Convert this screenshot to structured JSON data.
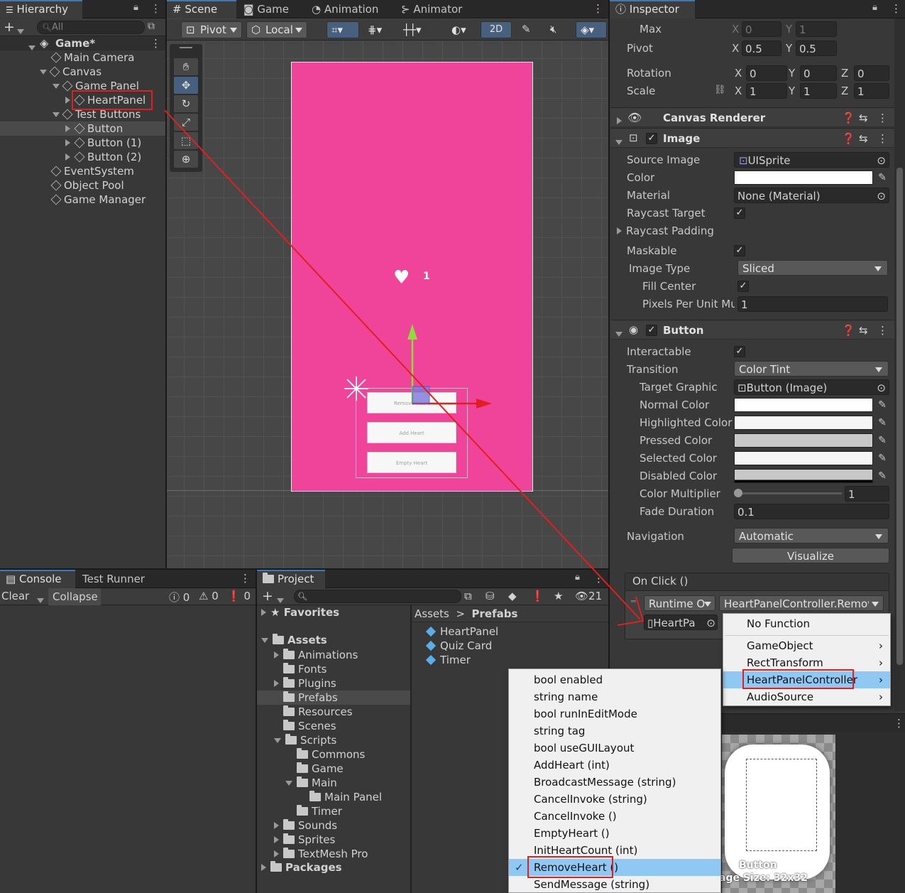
{
  "hierarchy": {
    "tab": "Hierarchy",
    "search_placeholder": "All",
    "scene_name": "Game*",
    "items": [
      {
        "label": "Main Camera"
      },
      {
        "label": "Canvas"
      },
      {
        "label": "Game Panel"
      },
      {
        "label": "HeartPanel"
      },
      {
        "label": "Test Buttons"
      },
      {
        "label": "Button"
      },
      {
        "label": "Button (1)"
      },
      {
        "label": "Button (2)"
      },
      {
        "label": "EventSystem"
      },
      {
        "label": "Object Pool"
      },
      {
        "label": "Game Manager"
      }
    ]
  },
  "scene": {
    "tabs": [
      "Scene",
      "Game",
      "Animation",
      "Animator"
    ],
    "pivot": "Pivot",
    "local": "Local",
    "mode_2d": "2D",
    "heart_count": "1",
    "buttons": [
      "Remove Heart",
      "Add Heart",
      "Empty Heart"
    ],
    "canvas_color": "#f0449a"
  },
  "console": {
    "tabs": [
      "Console",
      "Test Runner"
    ],
    "clear": "Clear",
    "collapse": "Collapse",
    "counts": [
      "0",
      "0",
      "0"
    ]
  },
  "project": {
    "tab": "Project",
    "hidden_count": "21",
    "breadcrumb": [
      "Assets",
      "Prefabs"
    ],
    "tree": [
      {
        "label": "Favorites"
      },
      {
        "label": "Assets"
      },
      {
        "label": "Animations"
      },
      {
        "label": "Fonts"
      },
      {
        "label": "Plugins"
      },
      {
        "label": "Prefabs"
      },
      {
        "label": "Resources"
      },
      {
        "label": "Scenes"
      },
      {
        "label": "Scripts"
      },
      {
        "label": "Commons"
      },
      {
        "label": "Game"
      },
      {
        "label": "Main"
      },
      {
        "label": "Main Panel"
      },
      {
        "label": "Timer"
      },
      {
        "label": "Sounds"
      },
      {
        "label": "Sprites"
      },
      {
        "label": "TextMesh Pro"
      },
      {
        "label": "Packages"
      }
    ],
    "assets": [
      "HeartPanel",
      "Quiz Card",
      "Timer"
    ]
  },
  "inspector": {
    "tab": "Inspector",
    "max_label": "Max",
    "max_x": "0",
    "max_y": "1",
    "pivot_label": "Pivot",
    "pivot_x": "0.5",
    "pivot_y": "0.5",
    "rotation_label": "Rotation",
    "rot": [
      "0",
      "0",
      "0"
    ],
    "scale_label": "Scale",
    "scale": [
      "1",
      "1",
      "1"
    ],
    "axis": [
      "X",
      "Y",
      "Z"
    ],
    "canvas_renderer": "Canvas Renderer",
    "image": {
      "title": "Image",
      "source_image_label": "Source Image",
      "source_image": "UISprite",
      "color_label": "Color",
      "material_label": "Material",
      "material": "None (Material)",
      "raycast_target_label": "Raycast Target",
      "raycast_padding_label": "Raycast Padding",
      "maskable_label": "Maskable",
      "image_type_label": "Image Type",
      "image_type": "Sliced",
      "fill_center_label": "Fill Center",
      "ppu_label": "Pixels Per Unit Mu",
      "ppu": "1"
    },
    "button": {
      "title": "Button",
      "interactable_label": "Interactable",
      "transition_label": "Transition",
      "transition": "Color Tint",
      "target_graphic_label": "Target Graphic",
      "target_graphic": "Button (Image)",
      "normal_label": "Normal Color",
      "highlighted_label": "Highlighted Color",
      "pressed_label": "Pressed Color",
      "selected_label": "Selected Color",
      "disabled_label": "Disabled Color",
      "multiplier_label": "Color Multiplier",
      "multiplier": "1",
      "fade_label": "Fade Duration",
      "fade": "0.1",
      "navigation_label": "Navigation",
      "navigation": "Automatic",
      "visualize": "Visualize"
    },
    "onclick": {
      "title": "On Click ()",
      "runtime": "Runtime O",
      "function": "HeartPanelController.Remov",
      "target": "HeartPa"
    },
    "preview_label": "Button",
    "preview_size": "age Size: 32x32"
  },
  "function_menu": {
    "items": [
      "No Function",
      "GameObject",
      "RectTransform",
      "HeartPanelController",
      "AudioSource"
    ]
  },
  "method_menu": {
    "items": [
      "bool enabled",
      "string name",
      "bool runInEditMode",
      "string tag",
      "bool useGUILayout",
      "AddHeart (int)",
      "BroadcastMessage (string)",
      "CancelInvoke (string)",
      "CancelInvoke ()",
      "EmptyHeart ()",
      "InitHeartCount (int)",
      "RemoveHeart ()",
      "SendMessage (string)"
    ],
    "selected": "RemoveHeart ()"
  },
  "colors": {
    "accent": "#3a79bb",
    "highlight_red": "#e0201e",
    "menu_selected": "#90c8f4"
  }
}
